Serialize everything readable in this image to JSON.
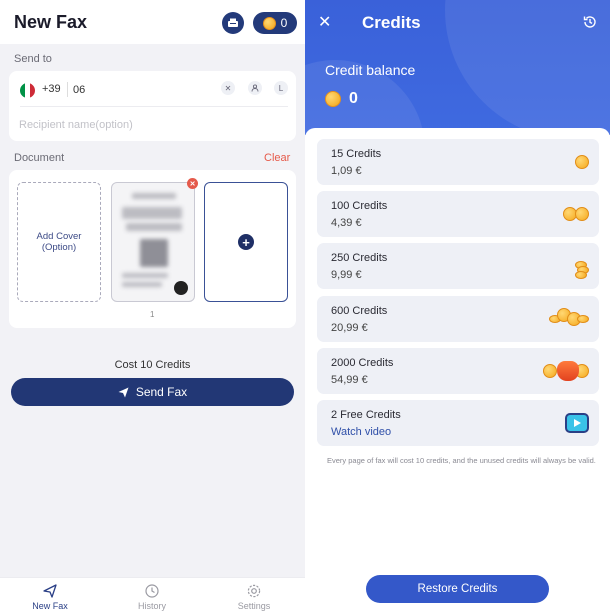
{
  "left": {
    "title": "New Fax",
    "coin_count": "0",
    "send_to_label": "Send to",
    "country_code": "+39",
    "fax_number_value": "06",
    "recipient_placeholder": "Recipient name(option)",
    "document_label": "Document",
    "clear_label": "Clear",
    "add_cover_label": "Add Cover\n(Option)",
    "page_number": "1",
    "cost_text": "Cost 10 Credits",
    "send_fax_label": "Send Fax",
    "tabs": [
      {
        "label": "New Fax",
        "icon": "send-icon",
        "active": true
      },
      {
        "label": "History",
        "icon": "history-icon",
        "active": false
      },
      {
        "label": "Settings",
        "icon": "settings-icon",
        "active": false
      }
    ]
  },
  "right": {
    "title": "Credits",
    "balance_label": "Credit balance",
    "balance_value": "0",
    "packages": [
      {
        "name": "15 Credits",
        "price": "1,09 €",
        "art": "coin-1"
      },
      {
        "name": "100 Credits",
        "price": "4,39 €",
        "art": "coin-2"
      },
      {
        "name": "250 Credits",
        "price": "9,99 €",
        "art": "coin-stack"
      },
      {
        "name": "600 Credits",
        "price": "20,99 €",
        "art": "coin-pile"
      },
      {
        "name": "2000 Credits",
        "price": "54,99 €",
        "art": "coin-bag"
      },
      {
        "name": "2 Free Credits",
        "price": "Watch video",
        "art": "video-tv"
      }
    ],
    "note": "Every page of fax will cost 10 credits, and the unused credits will always be valid.",
    "restore_label": "Restore Credits"
  },
  "colors": {
    "primary_navy": "#223775",
    "hero_blue": "#3a61d9",
    "danger": "#e65a4a",
    "coin_gold": "#f5a81c"
  }
}
